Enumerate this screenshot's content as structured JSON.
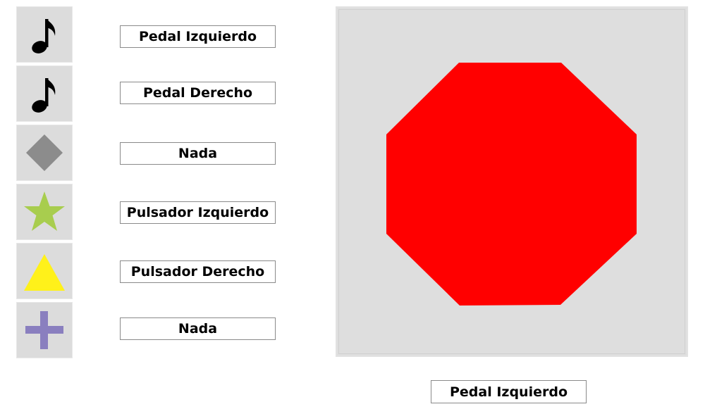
{
  "mappings": [
    {
      "icon": "music-note-icon",
      "label": "Pedal Izquierdo"
    },
    {
      "icon": "music-note-icon",
      "label": "Pedal Derecho"
    },
    {
      "icon": "diamond-icon",
      "label": "Nada"
    },
    {
      "icon": "star-icon",
      "label": "Pulsador Izquierdo"
    },
    {
      "icon": "triangle-icon",
      "label": "Pulsador Derecho"
    },
    {
      "icon": "plus-icon",
      "label": "Nada"
    }
  ],
  "preview": {
    "shape": "octagon",
    "color": "#ff0000"
  },
  "selected": {
    "label": "Pedal Izquierdo"
  },
  "colors": {
    "tile_bg": "#dcdcdc",
    "diamond": "#8c8c8c",
    "star": "#a8cd4e",
    "triangle": "#fff11a",
    "plus": "#8a7fbf",
    "note": "#000000"
  }
}
